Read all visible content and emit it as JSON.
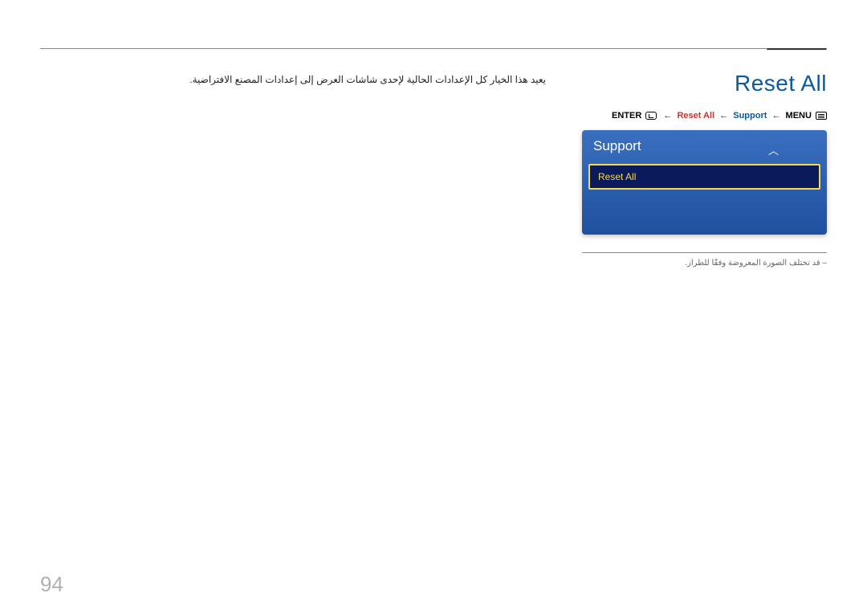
{
  "page": {
    "title": "Reset All",
    "description": "يعيد هذا الخيار كل الإعدادات الحالية لإحدى شاشات العرض إلى إعدادات المصنع الافتراضية.",
    "page_number": "94"
  },
  "breadcrumb": {
    "enter": "ENTER",
    "arrow": "←",
    "reset_all": "Reset All",
    "support": "Support",
    "menu": "MENU"
  },
  "osd": {
    "header": "Support",
    "item": "Reset All"
  },
  "footnote": "قد تختلف الصورة المعروضة وفقًا للطراز."
}
